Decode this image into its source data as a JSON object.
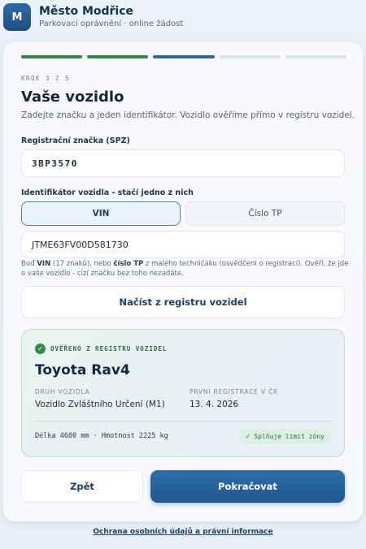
{
  "header": {
    "logo_letter": "M",
    "title": "Město Modřice",
    "subtitle": "Parkovací oprávnění · online žádost"
  },
  "progress": {
    "total_steps": 5,
    "current_step": 3,
    "completed_steps": 2
  },
  "step": {
    "label": "KROK 3 Z 5",
    "title": "Vaše vozidlo",
    "description": "Zadejte značku a jeden identifikátor. Vozidlo ověříme přímo v registru vozidel."
  },
  "plate_field": {
    "label": "Registrační značka (SPZ)",
    "value": "3BP3570"
  },
  "identifier": {
    "label": "Identifikátor vozidla - stačí jedno z nich",
    "options": [
      "VIN",
      "Číslo TP"
    ],
    "selected": "VIN",
    "value": "JTME63FV00D581730",
    "hint_parts": [
      "Buď ",
      "VIN",
      " (17 znaků), nebo ",
      "číslo TP",
      " z malého techničáku (osvědčení o registraci). Ověří, že jde o vaše vozidlo - cizí značku bez toho nezadáte."
    ]
  },
  "load_button": "Načíst z registru vozidel",
  "verified": {
    "badge": "OVĚŘENO Z REGISTRU VOZIDEL",
    "car_name": "Toyota Rav4",
    "type_label": "DRUH VOZIDLA",
    "type_value": "Vozidlo Zvláštního Určení (M1)",
    "reg_label": "PRVNÍ REGISTRACE V ČR",
    "reg_value": "13. 4. 2026",
    "specs": "Délka 4600 mm · Hmotnost 2225 kg",
    "limit_badge": "Splňuje limit zóny"
  },
  "actions": {
    "back": "Zpět",
    "continue": "Pokračovat"
  },
  "footer": {
    "link": "Ochrana osobních údajů a právní informace"
  },
  "colors": {
    "accent": "#2a6aa8",
    "success": "#2f8a4c",
    "progress_todo": "#dde3ea"
  }
}
